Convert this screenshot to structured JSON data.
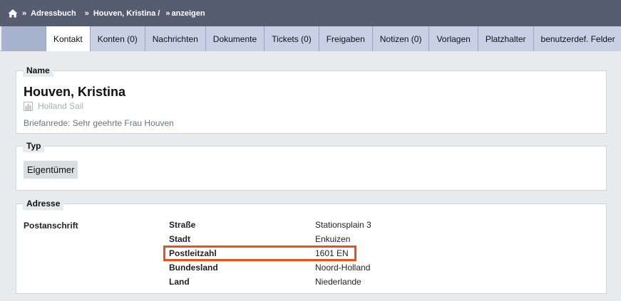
{
  "breadcrumb": {
    "items": [
      "Adressbuch",
      "Houven, Kristina /",
      "anzeigen"
    ],
    "separator": "»"
  },
  "tabs": [
    {
      "label": "Kontakt",
      "active": true
    },
    {
      "label": "Konten (0)"
    },
    {
      "label": "Nachrichten"
    },
    {
      "label": "Dokumente"
    },
    {
      "label": "Tickets (0)"
    },
    {
      "label": "Freigaben"
    },
    {
      "label": "Notizen (0)"
    },
    {
      "label": "Vorlagen"
    },
    {
      "label": "Platzhalter"
    },
    {
      "label": "benutzerdef. Felder"
    }
  ],
  "name_section": {
    "legend": "Name",
    "full_name": "Houven, Kristina",
    "company": "Holland Sail",
    "salutation": "Briefanrede: Sehr geehrte Frau Houven"
  },
  "type_section": {
    "legend": "Typ",
    "value": "Eigentümer"
  },
  "address_section": {
    "legend": "Adresse",
    "label": "Postanschrift",
    "rows": [
      {
        "key": "Straße",
        "value": "Stationsplain 3"
      },
      {
        "key": "Stadt",
        "value": "Enkuizen"
      },
      {
        "key": "Postleitzahl",
        "value": "1601 EN"
      },
      {
        "key": "Bundesland",
        "value": "Noord-Holland"
      },
      {
        "key": "Land",
        "value": "Niederlande"
      }
    ]
  },
  "colors": {
    "topbar": "#575d70",
    "tab_inactive": "#c7d0e4",
    "tab_active": "#ffffff",
    "highlight": "#e8501d"
  },
  "icons": [
    "home-icon",
    "building-icon"
  ]
}
